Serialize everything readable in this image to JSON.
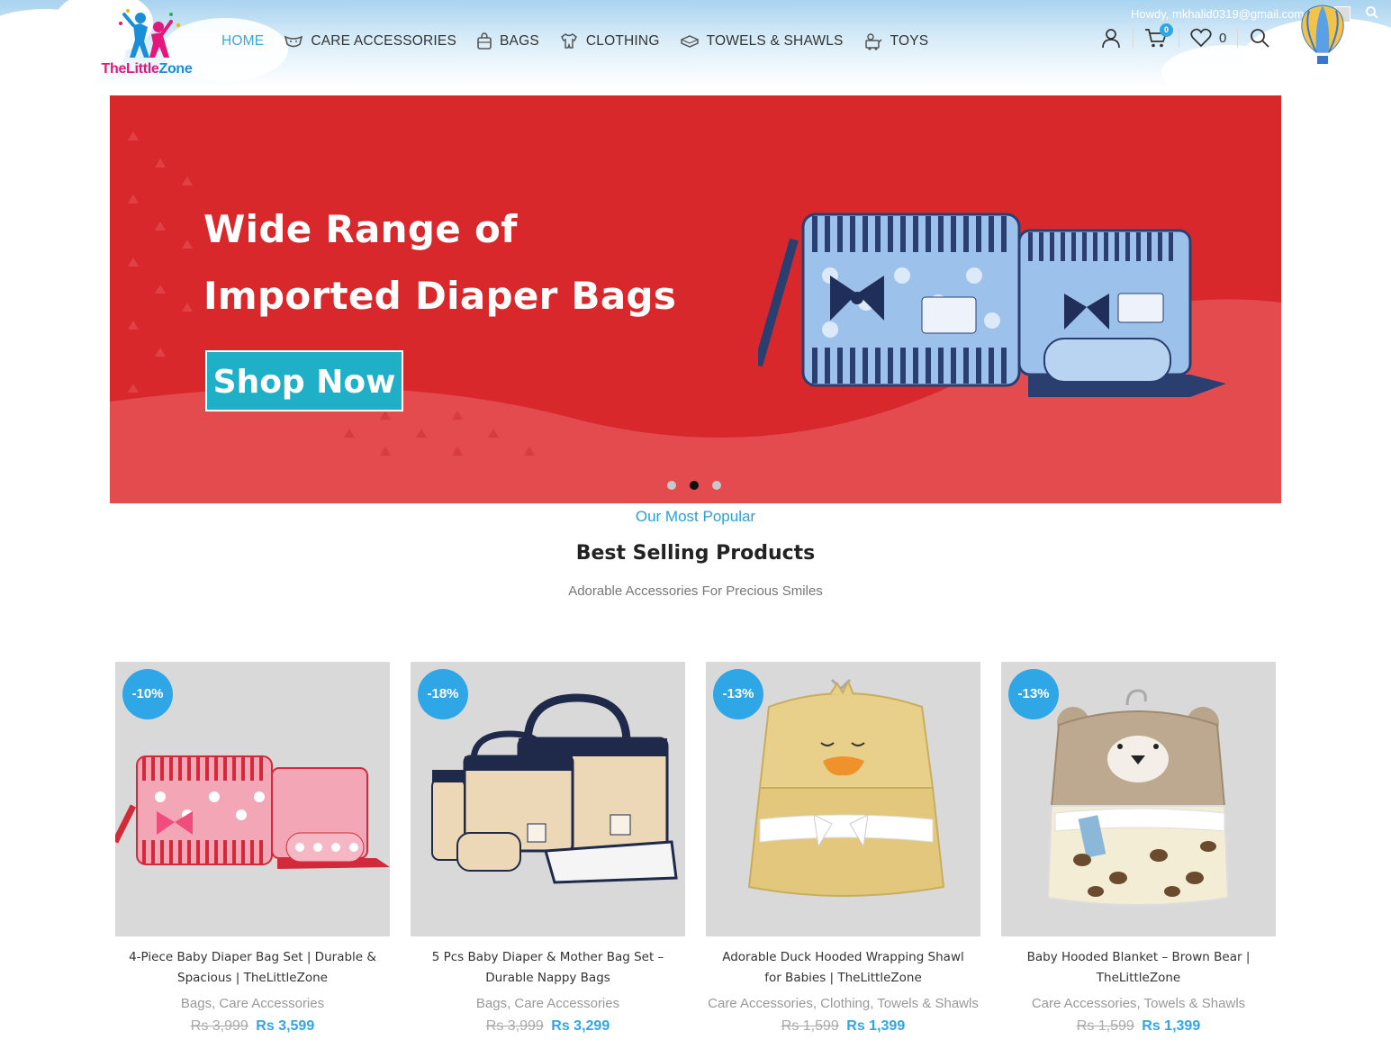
{
  "header": {
    "logo": {
      "text_the": "The",
      "text_little": "Little",
      "text_zone": "Zone"
    },
    "nav": [
      {
        "label": "HOME",
        "icon": "none",
        "active": true
      },
      {
        "label": "CARE ACCESSORIES",
        "icon": "diaper-icon"
      },
      {
        "label": "BAGS",
        "icon": "bag-icon"
      },
      {
        "label": "CLOTHING",
        "icon": "onesie-icon"
      },
      {
        "label": "TOWELS & SHAWLS",
        "icon": "towel-icon"
      },
      {
        "label": "TOYS",
        "icon": "toy-icon"
      }
    ],
    "cart_count": "0",
    "wishlist_count": "0",
    "admin_bar": {
      "howdy": "Howdy, mkhalid0319@gmail.com"
    }
  },
  "slider": {
    "title_line1": "Wide Range of",
    "title_line2": "Imported Diaper Bags",
    "button": "Shop Now",
    "slides": 3,
    "active_slide": 2,
    "colors": {
      "background": "#d8282b",
      "button": "#1fb0c8"
    }
  },
  "section": {
    "eyebrow": "Our Most Popular",
    "title": "Best Selling Products",
    "subtitle": "Adorable Accessories For Precious Smiles"
  },
  "products": [
    {
      "badge": "-10%",
      "name": "4-Piece Baby Diaper Bag Set | Durable & Spacious | TheLittleZone",
      "categories": "Bags, Care Accessories",
      "old_price": "Rs 3,999",
      "new_price": "Rs 3,599",
      "image": "pink-diaper-bag-set"
    },
    {
      "badge": "-18%",
      "name": "5 Pcs Baby Diaper & Mother Bag Set – Durable Nappy Bags",
      "categories": "Bags, Care Accessories",
      "old_price": "Rs 3,999",
      "new_price": "Rs 3,299",
      "image": "beige-navy-bag-set"
    },
    {
      "badge": "-13%",
      "name": "Adorable Duck Hooded Wrapping Shawl for Babies | TheLittleZone",
      "categories": "Care Accessories, Clothing, Towels & Shawls",
      "old_price": "Rs 1,599",
      "new_price": "Rs 1,399",
      "image": "duck-hooded-shawl"
    },
    {
      "badge": "-13%",
      "name": "Baby Hooded Blanket – Brown Bear | TheLittleZone",
      "categories": "Care Accessories, Towels & Shawls",
      "old_price": "Rs 1,599",
      "new_price": "Rs 1,399",
      "image": "bear-hooded-blanket"
    }
  ],
  "colors": {
    "accent": "#2fa6e6",
    "brand_pink": "#e2187c",
    "text": "#333333"
  }
}
